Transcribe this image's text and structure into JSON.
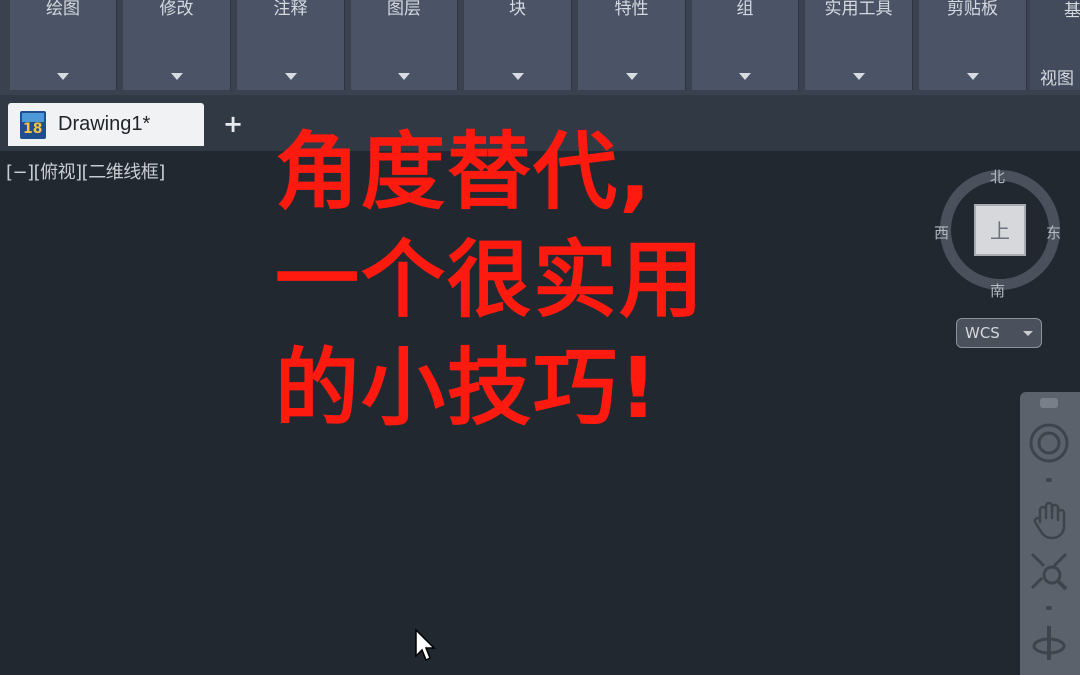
{
  "ribbon": {
    "panels": [
      {
        "label": "绘图"
      },
      {
        "label": "修改"
      },
      {
        "label": "注释"
      },
      {
        "label": "图层"
      },
      {
        "label": "块"
      },
      {
        "label": "特性"
      },
      {
        "label": "组"
      },
      {
        "label": "实用工具"
      },
      {
        "label": "剪贴板"
      }
    ],
    "edge_top": "基",
    "edge_bottom": "视图"
  },
  "tabs": {
    "doc_title": "Drawing1*",
    "app_icon_number": "18",
    "new_tab": "+"
  },
  "viewport": {
    "view_label": "[−][俯视][二维线框]"
  },
  "overlay": {
    "lines": [
      "角度替代,",
      "一个很实用",
      "的小技巧!"
    ],
    "color": "#ff1a0f"
  },
  "viewcube": {
    "north": "北",
    "south": "南",
    "west": "西",
    "east": "东",
    "face": "上",
    "wcs": "WCS"
  }
}
